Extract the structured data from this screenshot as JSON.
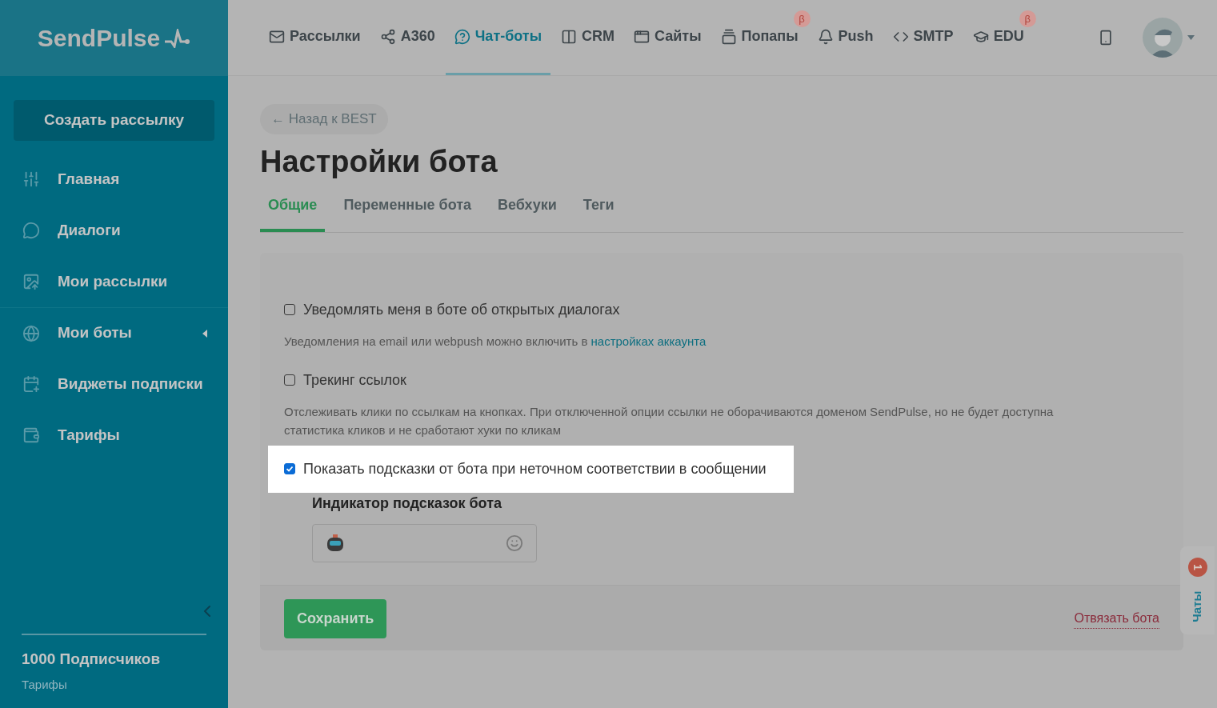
{
  "logo": "SendPulse",
  "nav": [
    {
      "label": "Рассылки",
      "selected": false
    },
    {
      "label": "A360",
      "selected": false
    },
    {
      "label": "Чат-боты",
      "selected": true
    },
    {
      "label": "CRM",
      "selected": false
    },
    {
      "label": "Сайты",
      "selected": false
    },
    {
      "label": "Попапы",
      "selected": false,
      "badge": "β"
    },
    {
      "label": "Push",
      "selected": false
    },
    {
      "label": "SMTP",
      "selected": false
    },
    {
      "label": "EDU",
      "selected": false,
      "badge": "β"
    }
  ],
  "sidebar": {
    "create_button": "Создать рассылку",
    "items": [
      {
        "label": "Главная",
        "expandable": false
      },
      {
        "label": "Диалоги",
        "expandable": false
      },
      {
        "label": "Мои рассылки",
        "expandable": false
      },
      {
        "label": "Мои боты",
        "expandable": true
      },
      {
        "label": "Виджеты подписки",
        "expandable": false
      },
      {
        "label": "Тарифы",
        "expandable": false
      }
    ],
    "plan": "1000 Подписчиков",
    "plan_link": "Тарифы"
  },
  "back_link": "← Назад к BEST",
  "title": "Настройки бота",
  "tabs": [
    {
      "label": "Общие",
      "selected": true
    },
    {
      "label": "Переменные бота",
      "selected": false
    },
    {
      "label": "Вебхуки",
      "selected": false
    },
    {
      "label": "Теги",
      "selected": false
    }
  ],
  "options": [
    {
      "label": "Уведомлять меня в боте об открытых диалогах",
      "checked": false,
      "highlighted": false,
      "description": "Уведомления на email или webpush можно включить в",
      "description_link": "настройках аккаунта"
    },
    {
      "label": "Трекинг ссылок",
      "checked": false,
      "highlighted": false,
      "description": "Отслеживать клики по ссылкам на кнопках. При отключенной опции ссылки не оборачиваются доменом SendPulse, но не будет доступна статистика кликов и не сработают хуки по кликам"
    },
    {
      "label": "Показать подсказки от бота при неточном соответствии в сообщении",
      "checked": true,
      "highlighted": true
    }
  ],
  "indicator": {
    "label": "Индикатор подсказок бота"
  },
  "save_button": "Сохранить",
  "unlink_link": "Отвязать бота",
  "chats": {
    "label": "Чаты",
    "count": "1"
  }
}
